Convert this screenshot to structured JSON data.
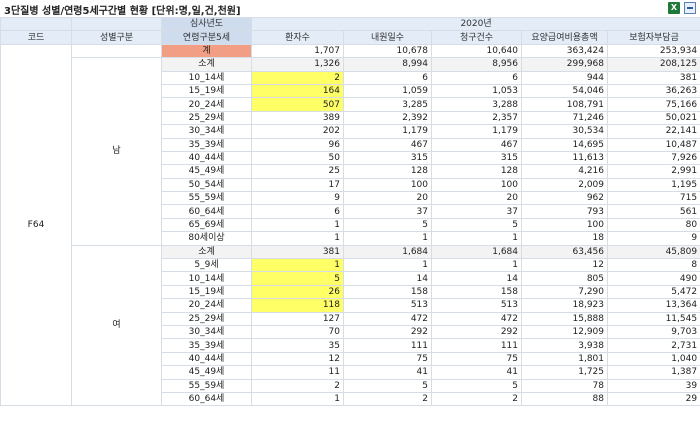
{
  "title": "3단질병 성별/연령5세구간별 현황 [단위:명,일,건,천원]",
  "icons": {
    "export": "excel-icon",
    "collapse": "collapse-icon"
  },
  "header": {
    "year_group_label": "심사년도",
    "year": "2020년",
    "age_group_label": "연령구분5세",
    "code": "코드",
    "sex": "성별구분",
    "metrics": [
      "환자수",
      "내원일수",
      "청구건수",
      "요양급여비용총액",
      "보험자부담금"
    ]
  },
  "code_value": "F64",
  "total": {
    "label": "계",
    "values": [
      "1,707",
      "10,678",
      "10,640",
      "363,424",
      "253,934"
    ]
  },
  "groups": [
    {
      "sex": "남",
      "subtotal": {
        "label": "소계",
        "values": [
          "1,326",
          "8,994",
          "8,956",
          "299,968",
          "208,125"
        ]
      },
      "rows": [
        {
          "age": "10_14세",
          "values": [
            "2",
            "6",
            "6",
            "944",
            "381"
          ],
          "hl": true
        },
        {
          "age": "15_19세",
          "values": [
            "164",
            "1,059",
            "1,053",
            "54,046",
            "36,263"
          ],
          "hl": true
        },
        {
          "age": "20_24세",
          "values": [
            "507",
            "3,285",
            "3,288",
            "108,791",
            "75,166"
          ],
          "hl": true
        },
        {
          "age": "25_29세",
          "values": [
            "389",
            "2,392",
            "2,357",
            "71,246",
            "50,021"
          ]
        },
        {
          "age": "30_34세",
          "values": [
            "202",
            "1,179",
            "1,179",
            "30,534",
            "22,141"
          ]
        },
        {
          "age": "35_39세",
          "values": [
            "96",
            "467",
            "467",
            "14,695",
            "10,487"
          ]
        },
        {
          "age": "40_44세",
          "values": [
            "50",
            "315",
            "315",
            "11,613",
            "7,926"
          ]
        },
        {
          "age": "45_49세",
          "values": [
            "25",
            "128",
            "128",
            "4,216",
            "2,991"
          ]
        },
        {
          "age": "50_54세",
          "values": [
            "17",
            "100",
            "100",
            "2,009",
            "1,195"
          ]
        },
        {
          "age": "55_59세",
          "values": [
            "9",
            "20",
            "20",
            "962",
            "715"
          ]
        },
        {
          "age": "60_64세",
          "values": [
            "6",
            "37",
            "37",
            "793",
            "561"
          ]
        },
        {
          "age": "65_69세",
          "values": [
            "1",
            "5",
            "5",
            "100",
            "80"
          ]
        },
        {
          "age": "80세이상",
          "values": [
            "1",
            "1",
            "1",
            "18",
            "9"
          ]
        }
      ]
    },
    {
      "sex": "여",
      "subtotal": {
        "label": "소계",
        "values": [
          "381",
          "1,684",
          "1,684",
          "63,456",
          "45,809"
        ]
      },
      "rows": [
        {
          "age": "5_9세",
          "values": [
            "1",
            "1",
            "1",
            "12",
            "8"
          ],
          "hl": true
        },
        {
          "age": "10_14세",
          "values": [
            "5",
            "14",
            "14",
            "805",
            "490"
          ],
          "hl": true
        },
        {
          "age": "15_19세",
          "values": [
            "26",
            "158",
            "158",
            "7,290",
            "5,472"
          ],
          "hl": true
        },
        {
          "age": "20_24세",
          "values": [
            "118",
            "513",
            "513",
            "18,923",
            "13,364"
          ],
          "hl": true
        },
        {
          "age": "25_29세",
          "values": [
            "127",
            "472",
            "472",
            "15,888",
            "11,545"
          ]
        },
        {
          "age": "30_34세",
          "values": [
            "70",
            "292",
            "292",
            "12,909",
            "9,703"
          ]
        },
        {
          "age": "35_39세",
          "values": [
            "35",
            "111",
            "111",
            "3,938",
            "2,731"
          ]
        },
        {
          "age": "40_44세",
          "values": [
            "12",
            "75",
            "75",
            "1,801",
            "1,040"
          ]
        },
        {
          "age": "45_49세",
          "values": [
            "11",
            "41",
            "41",
            "1,725",
            "1,387"
          ]
        },
        {
          "age": "55_59세",
          "values": [
            "2",
            "5",
            "5",
            "78",
            "39"
          ]
        },
        {
          "age": "60_64세",
          "values": [
            "1",
            "2",
            "2",
            "88",
            "29"
          ]
        }
      ]
    }
  ]
}
